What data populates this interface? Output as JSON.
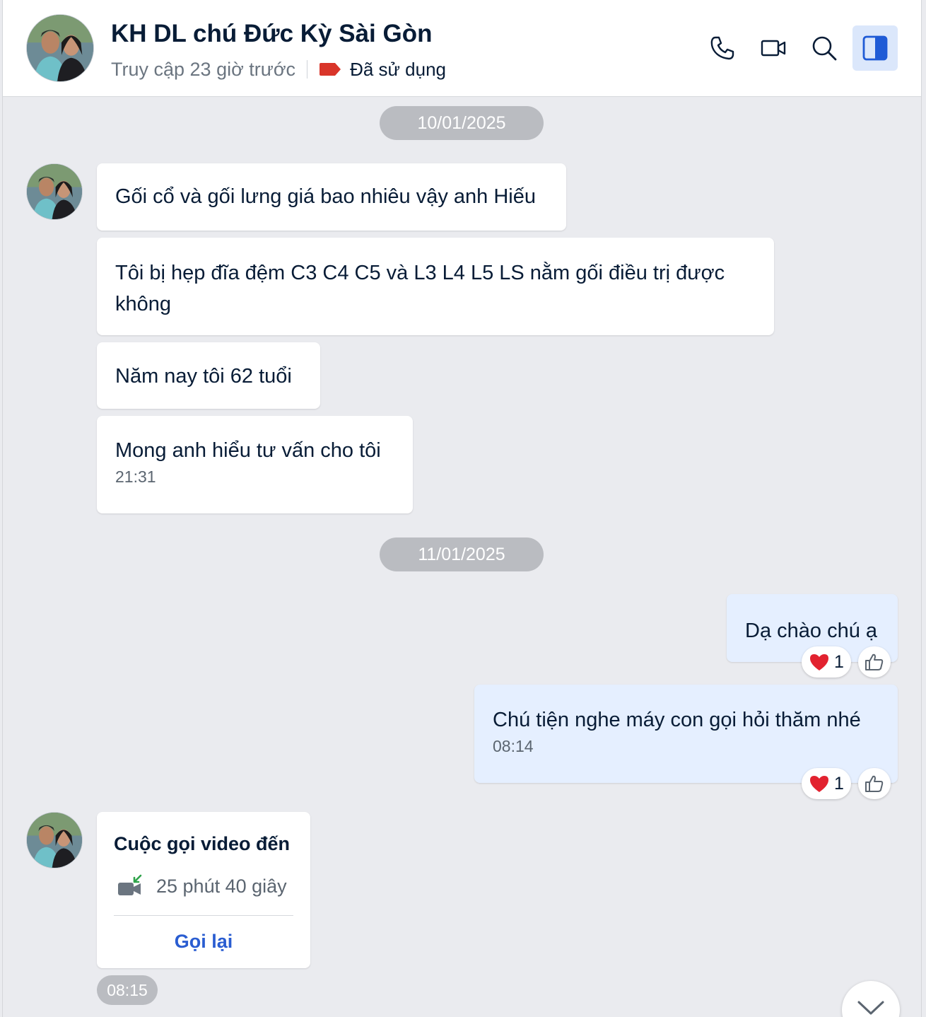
{
  "header": {
    "title": "KH DL chú Đức Kỳ Sài Gòn",
    "last_seen": "Truy cập 23 giờ trước",
    "tag_label": "Đã sử dụng",
    "tag_color": "#d9352a",
    "buttons": [
      "phone-icon",
      "video-call-icon",
      "search-icon",
      "sidebar-toggle-icon"
    ]
  },
  "dates": [
    "10/01/2025",
    "11/01/2025"
  ],
  "messages": {
    "m1": "Gối cổ và gối lưng giá bao nhiêu vậy anh Hiếu",
    "m2_line1": "Tôi bị hẹp đĩa đệm C3 C4 C5 và L3 L4 L5 LS nằm gối điều trị được",
    "m2_line2": "không",
    "m3": "Năm nay tôi 62 tuổi",
    "m4": "Mong anh hiểu tư vấn cho tôi",
    "m4_time": "21:31",
    "m5": "Dạ chào chú ạ",
    "m5_heart_count": "1",
    "m6": "Chú tiện nghe máy con gọi hỏi thăm nhé",
    "m6_time": "08:14",
    "m6_heart_count": "1"
  },
  "call": {
    "title": "Cuộc gọi video đến",
    "duration": "25 phút 40 giây",
    "callback_label": "Gọi lại",
    "time": "08:15"
  },
  "colors": {
    "accent": "#2a5dd1",
    "mine_bubble": "#e5efff",
    "background": "#eaebef"
  }
}
